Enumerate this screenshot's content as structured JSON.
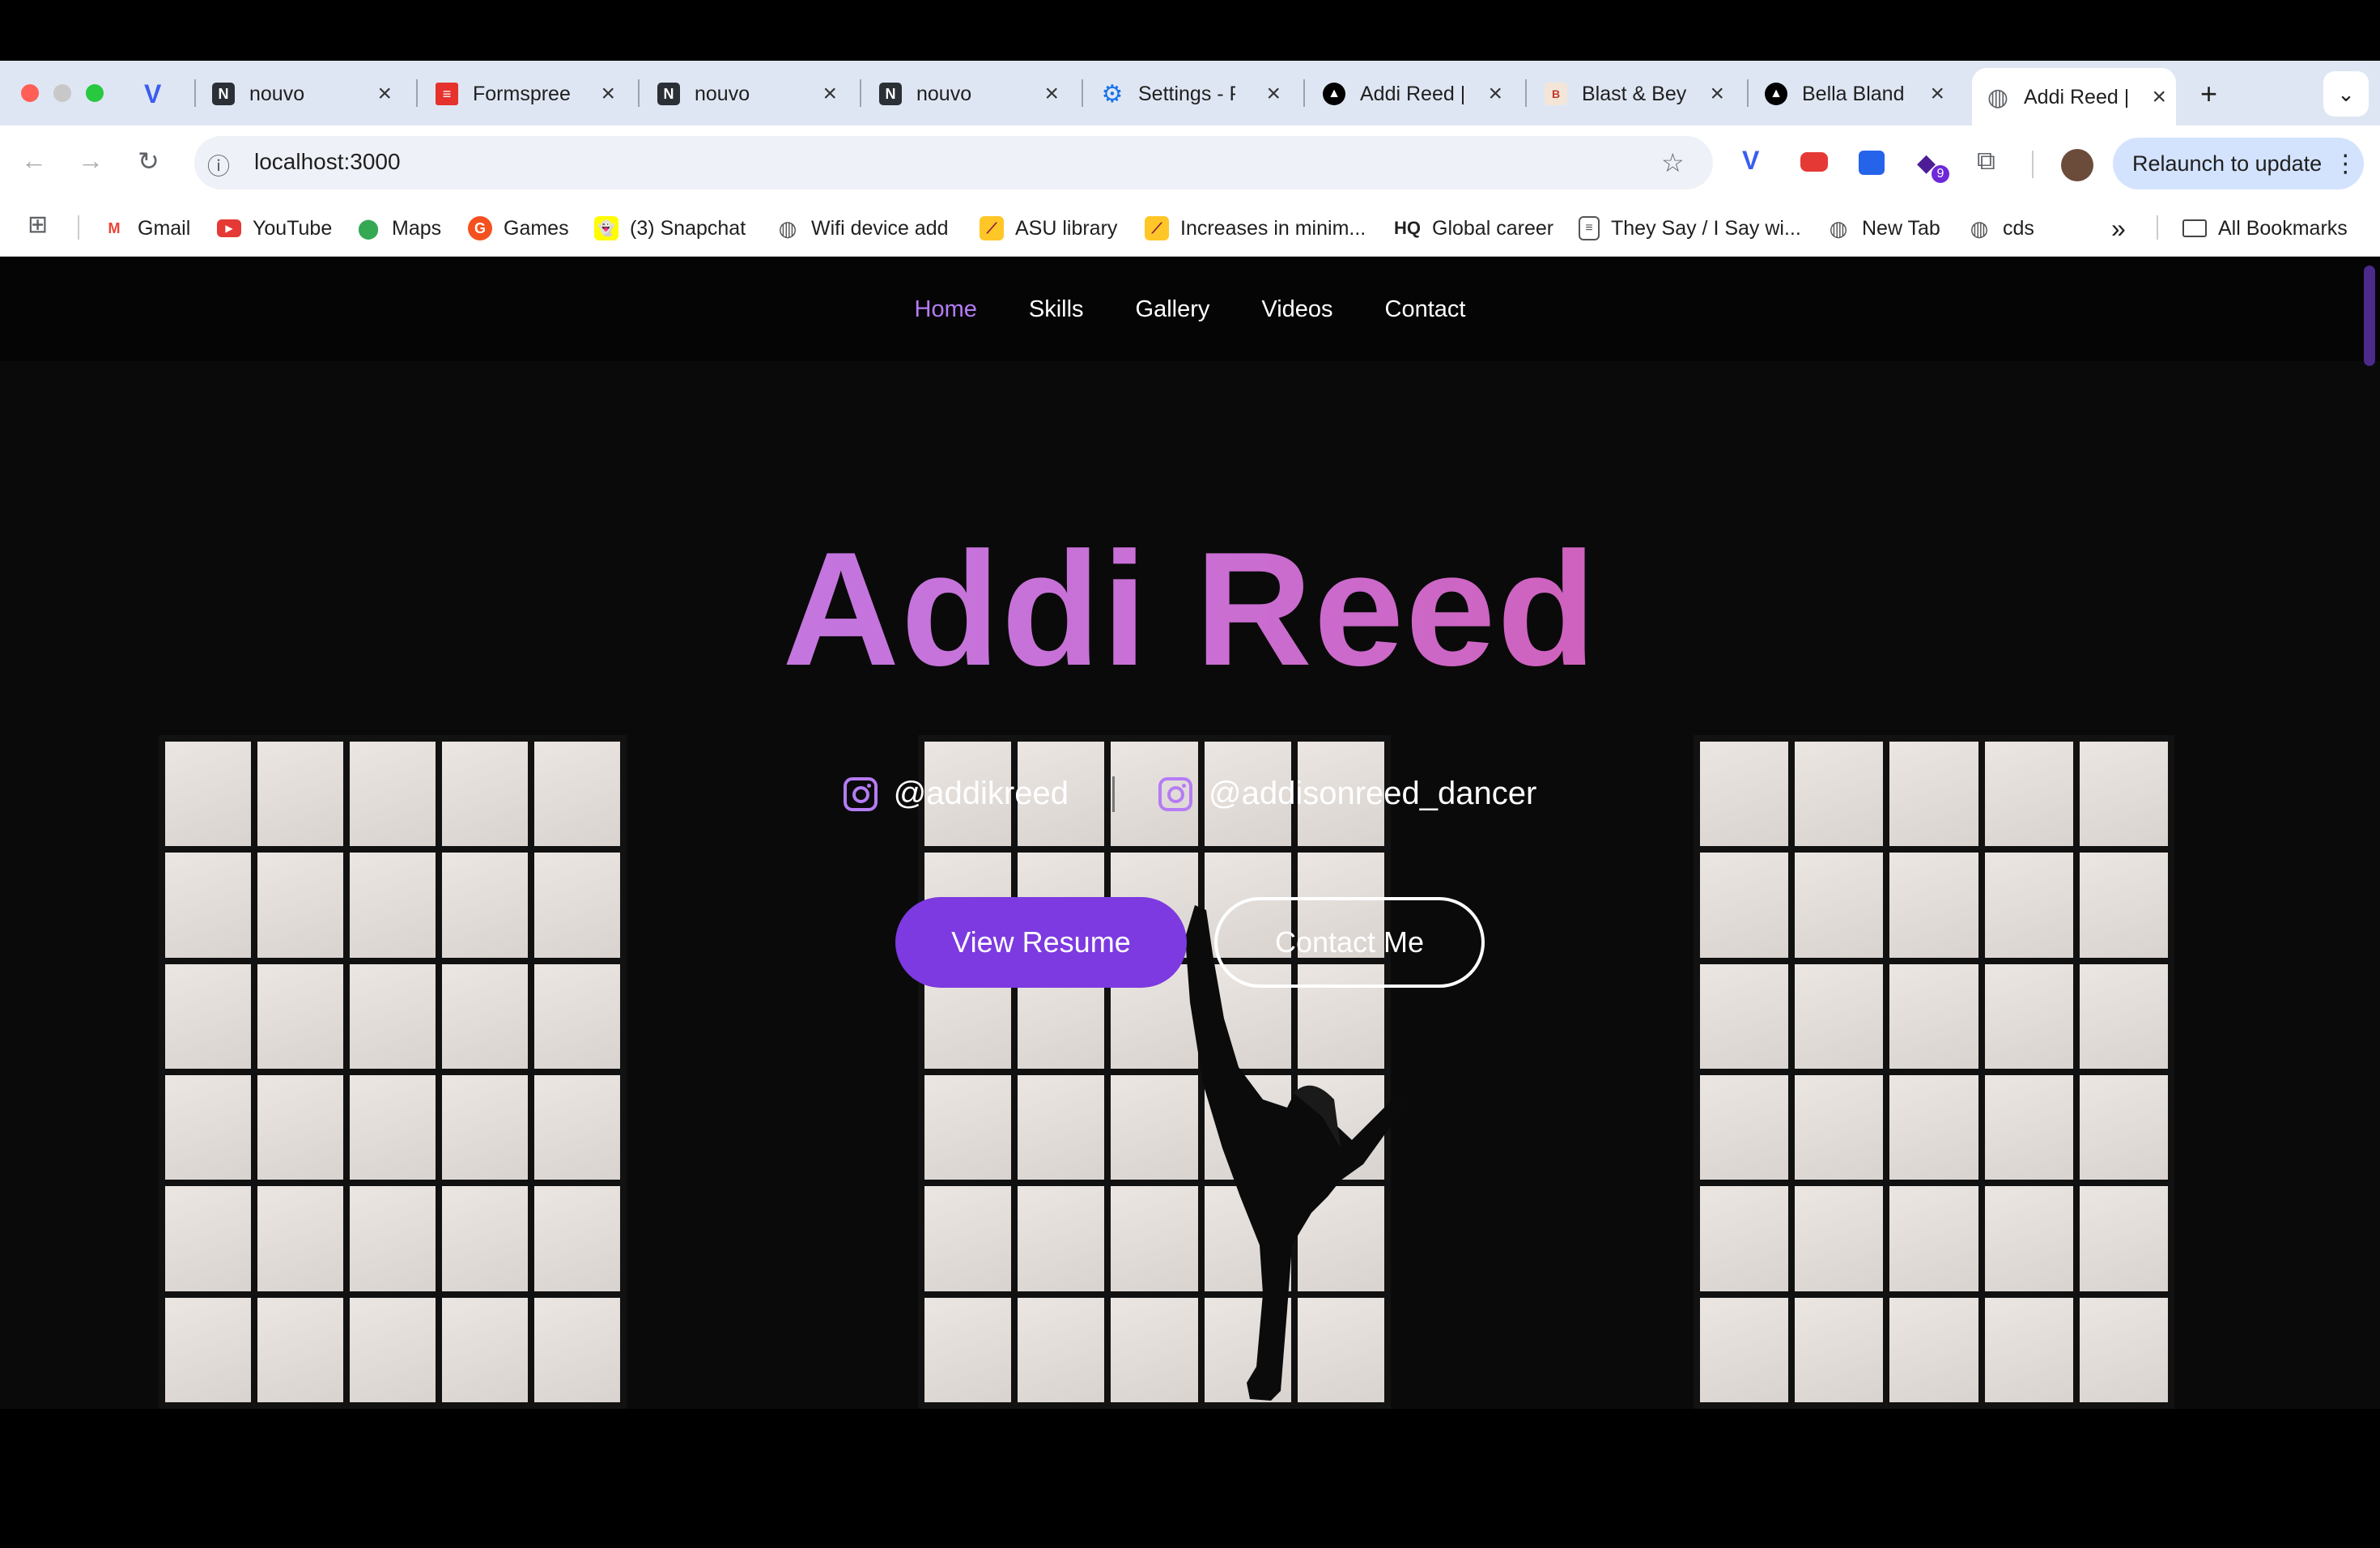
{
  "browser": {
    "tabs": [
      {
        "title": "",
        "favicon": "vivaldi-icon"
      },
      {
        "title": "nouvo",
        "favicon": "N"
      },
      {
        "title": "Formspree",
        "favicon": "formspree-icon"
      },
      {
        "title": "nouvo",
        "favicon": "N"
      },
      {
        "title": "nouvo",
        "favicon": "N"
      },
      {
        "title": "Settings - P",
        "favicon": "gear-icon"
      },
      {
        "title": "Addi Reed |",
        "favicon": "triangle-icon"
      },
      {
        "title": "Blast & Bey",
        "favicon": "blast-icon"
      },
      {
        "title": "Bella Bland",
        "favicon": "triangle-icon"
      },
      {
        "title": "Addi Reed |",
        "favicon": "globe-icon",
        "active": true
      }
    ],
    "new_tab": "+",
    "url": "localhost:3000",
    "relaunch": "Relaunch to update",
    "extension_badge": "9",
    "bookmarks": [
      {
        "label": "Gmail",
        "icon": "gmail-icon"
      },
      {
        "label": "YouTube",
        "icon": "youtube-icon"
      },
      {
        "label": "Maps",
        "icon": "maps-icon"
      },
      {
        "label": "Games",
        "icon": "games-icon"
      },
      {
        "label": "(3) Snapchat",
        "icon": "snapchat-icon"
      },
      {
        "label": "Wifi device add",
        "icon": "globe-icon"
      },
      {
        "label": "ASU library",
        "icon": "asu-icon"
      },
      {
        "label": "Increases in minim...",
        "icon": "asu-icon"
      },
      {
        "label": "Global career",
        "icon": "hq-icon",
        "prefix": "HQ"
      },
      {
        "label": "They Say / I Say wi...",
        "icon": "doc-icon"
      },
      {
        "label": "New Tab",
        "icon": "globe-icon"
      },
      {
        "label": "cds",
        "icon": "globe-icon"
      }
    ],
    "more_bookmarks": "»",
    "all_bookmarks": "All Bookmarks"
  },
  "site": {
    "nav": [
      {
        "label": "Home",
        "active": true
      },
      {
        "label": "Skills"
      },
      {
        "label": "Gallery"
      },
      {
        "label": "Videos"
      },
      {
        "label": "Contact"
      }
    ],
    "hero": {
      "title": "Addi Reed",
      "instagram_1": "@addikreed",
      "instagram_2": "@addisonreed_dancer",
      "resume_button": "View Resume",
      "contact_button": "Contact Me"
    }
  },
  "colors": {
    "accent": "#b57cf5",
    "primary_button": "#7c3ae0",
    "gradient_start": "#b883f3",
    "gradient_end": "#d9478e",
    "tab_strip": "#dfe6f3",
    "relaunch_bg": "#d3e3fd"
  }
}
